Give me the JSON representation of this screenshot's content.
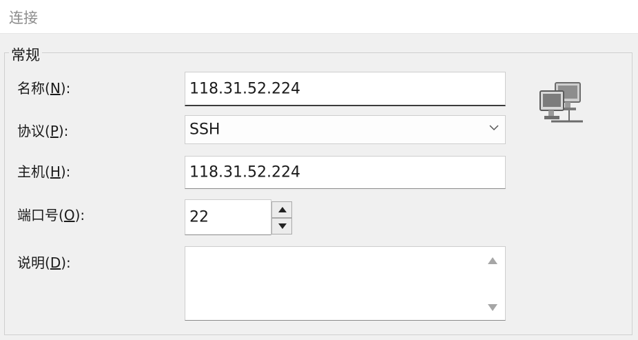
{
  "header": {
    "title": "连接"
  },
  "group": {
    "title": "常规"
  },
  "fields": {
    "name": {
      "label_pre": "名称(",
      "mnemonic": "N",
      "label_post": "):",
      "value": "118.31.52.224"
    },
    "protocol": {
      "label_pre": "协议(",
      "mnemonic": "P",
      "label_post": "):",
      "value": "SSH"
    },
    "host": {
      "label_pre": "主机(",
      "mnemonic": "H",
      "label_post": "):",
      "value": "118.31.52.224"
    },
    "port": {
      "label_pre": "端口号(",
      "mnemonic": "O",
      "label_post": "):",
      "value": "22"
    },
    "description": {
      "label_pre": "说明(",
      "mnemonic": "D",
      "label_post": "):",
      "value": ""
    }
  },
  "icons": {
    "protocol_dropdown": "chevron-down-icon",
    "port_up": "triangle-up-icon",
    "port_down": "triangle-down-icon",
    "connection": "network-computers-icon"
  },
  "colors": {
    "background": "#f0f0f0",
    "field_background": "#ffffff",
    "title_gray": "#8c8c8c"
  }
}
